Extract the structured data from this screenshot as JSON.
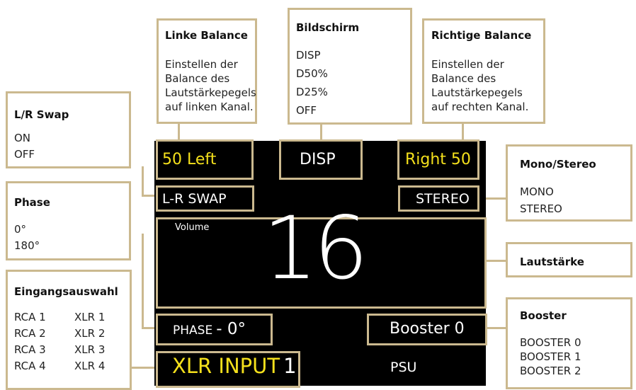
{
  "callouts": {
    "left_balance": {
      "title": "Linke Balance",
      "lines": [
        "Einstellen der",
        "Balance des",
        "Lautstärkepegels",
        "auf linken Kanal."
      ]
    },
    "display": {
      "title": "Bildschirm",
      "lines": [
        "DISP",
        "D50%",
        "D25%",
        "OFF"
      ]
    },
    "right_balance": {
      "title": "Richtige Balance",
      "lines": [
        "Einstellen der",
        "Balance des",
        "Lautstärkepegels",
        "auf rechten Kanal."
      ]
    },
    "lr_swap": {
      "title": "L/R Swap",
      "lines": [
        "ON",
        "OFF"
      ]
    },
    "mono_stereo": {
      "title": "Mono/Stereo",
      "lines": [
        "MONO",
        "STEREO"
      ]
    },
    "phase": {
      "title": "Phase",
      "lines": [
        "0°",
        "180°"
      ]
    },
    "volume": {
      "title": "Lautstärke"
    },
    "input_select": {
      "title": "Eingangsauswahl",
      "rca": [
        "RCA 1",
        "RCA 2",
        "RCA 3",
        "RCA 4"
      ],
      "xlr": [
        "XLR 1",
        "XLR 2",
        "XLR 3",
        "XLR 4"
      ]
    },
    "booster": {
      "title": "Booster",
      "lines": [
        "BOOSTER 0",
        "BOOSTER 1",
        "BOOSTER 2"
      ]
    }
  },
  "screen": {
    "left_balance": "50 Left",
    "display_mode": "DISP",
    "right_balance": "Right 50",
    "lr_swap": "L-R SWAP",
    "stereo": "STEREO",
    "volume_label": "Volume",
    "volume_value": "16",
    "phase_label": "PHASE",
    "phase_value": "- 0°",
    "booster": "Booster 0",
    "input_name": "XLR INPUT",
    "input_number": "1",
    "psu": "PSU"
  },
  "colors": {
    "accent": "#cbb98f",
    "screen_bg": "#000000",
    "highlight_text": "#f4e01c",
    "screen_text": "#ffffff"
  }
}
